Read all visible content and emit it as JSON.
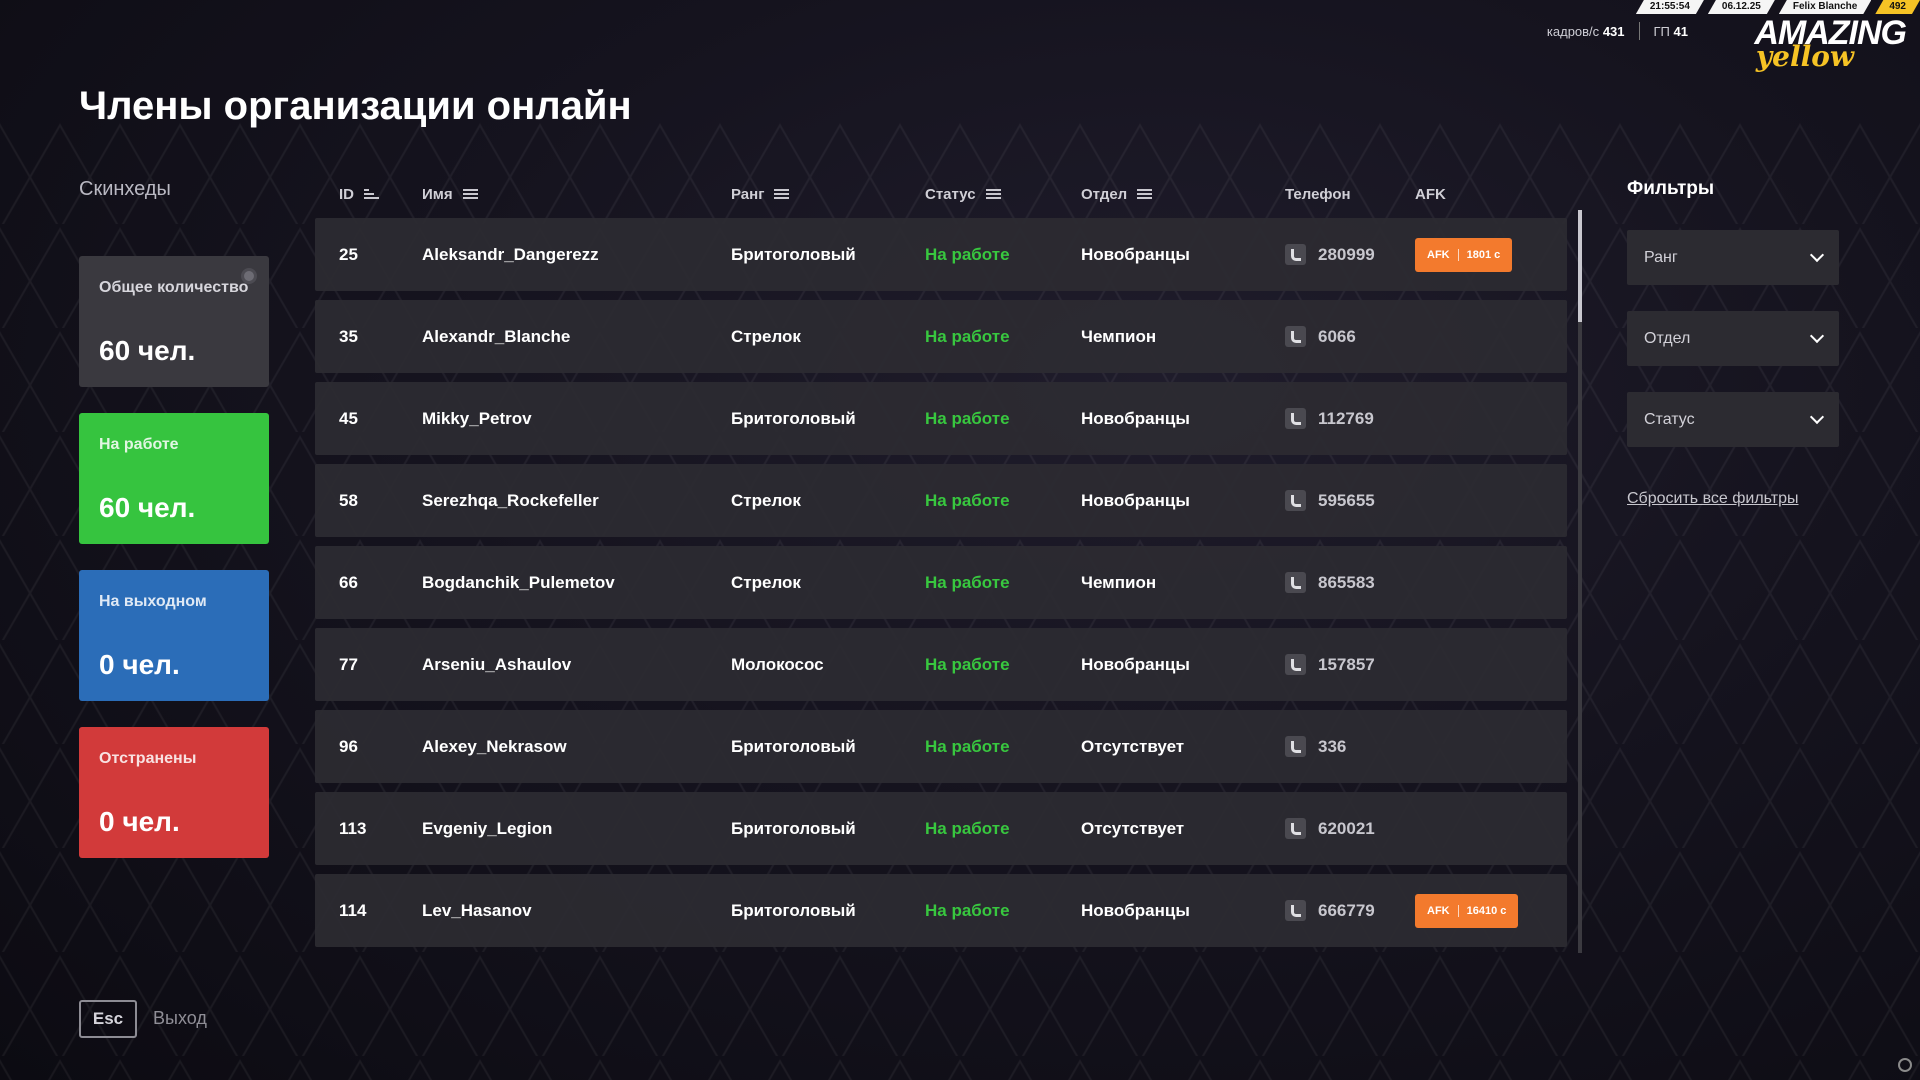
{
  "hud": {
    "time": "21:55:54",
    "date": "06.12.25",
    "player": "Felix Blanche",
    "counter": "492",
    "fps_label": "кадров/с",
    "fps_value": "431",
    "gp_label": "ГП",
    "gp_value": "41",
    "logo_main": "AMAZING",
    "logo_sub": "yellow"
  },
  "page": {
    "title": "Члены организации онлайн"
  },
  "sidebar": {
    "section_label": "Скинхеды",
    "cards": [
      {
        "label": "Общее количество",
        "value": "60 чел.",
        "color": "#3a393f"
      },
      {
        "label": "На работе",
        "value": "60 чел.",
        "color": "#36c43f"
      },
      {
        "label": "На выходном",
        "value": "0 чел.",
        "color": "#2b6db8"
      },
      {
        "label": "Отстранены",
        "value": "0 чел.",
        "color": "#d23a3a"
      }
    ]
  },
  "table": {
    "columns": {
      "id": "ID",
      "name": "Имя",
      "rank": "Ранг",
      "status": "Статус",
      "dept": "Отдел",
      "phone": "Телефон",
      "afk": "AFK"
    },
    "status_color": "#38c73f",
    "afk_color": "#f37a2d",
    "rows": [
      {
        "id": "25",
        "name": "Aleksandr_Dangerezz",
        "rank": "Бритоголовый",
        "status": "На работе",
        "dept": "Новобранцы",
        "phone": "280999",
        "afk_label": "AFK",
        "afk_time": "1801 с"
      },
      {
        "id": "35",
        "name": "Alexandr_Blanche",
        "rank": "Стрелок",
        "status": "На работе",
        "dept": "Чемпион",
        "phone": "6066"
      },
      {
        "id": "45",
        "name": "Mikky_Petrov",
        "rank": "Бритоголовый",
        "status": "На работе",
        "dept": "Новобранцы",
        "phone": "112769"
      },
      {
        "id": "58",
        "name": "Serezhqa_Rockefeller",
        "rank": "Стрелок",
        "status": "На работе",
        "dept": "Новобранцы",
        "phone": "595655"
      },
      {
        "id": "66",
        "name": "Bogdanchik_Pulemetov",
        "rank": "Стрелок",
        "status": "На работе",
        "dept": "Чемпион",
        "phone": "865583"
      },
      {
        "id": "77",
        "name": "Arseniu_Ashaulov",
        "rank": "Молокосос",
        "status": "На работе",
        "dept": "Новобранцы",
        "phone": "157857"
      },
      {
        "id": "96",
        "name": "Alexey_Nekrasow",
        "rank": "Бритоголовый",
        "status": "На работе",
        "dept": "Отсутствует",
        "phone": "336"
      },
      {
        "id": "113",
        "name": "Evgeniy_Legion",
        "rank": "Бритоголовый",
        "status": "На работе",
        "dept": "Отсутствует",
        "phone": "620021"
      },
      {
        "id": "114",
        "name": "Lev_Hasanov",
        "rank": "Бритоголовый",
        "status": "На работе",
        "dept": "Новобранцы",
        "phone": "666779",
        "afk_label": "AFK",
        "afk_time": "16410 с"
      }
    ]
  },
  "filters": {
    "title": "Фильтры",
    "selects": [
      {
        "value": "Ранг"
      },
      {
        "value": "Отдел"
      },
      {
        "value": "Статус"
      }
    ],
    "reset_label": "Сбросить все фильтры"
  },
  "footer": {
    "esc_key": "Esc",
    "exit_label": "Выход"
  }
}
